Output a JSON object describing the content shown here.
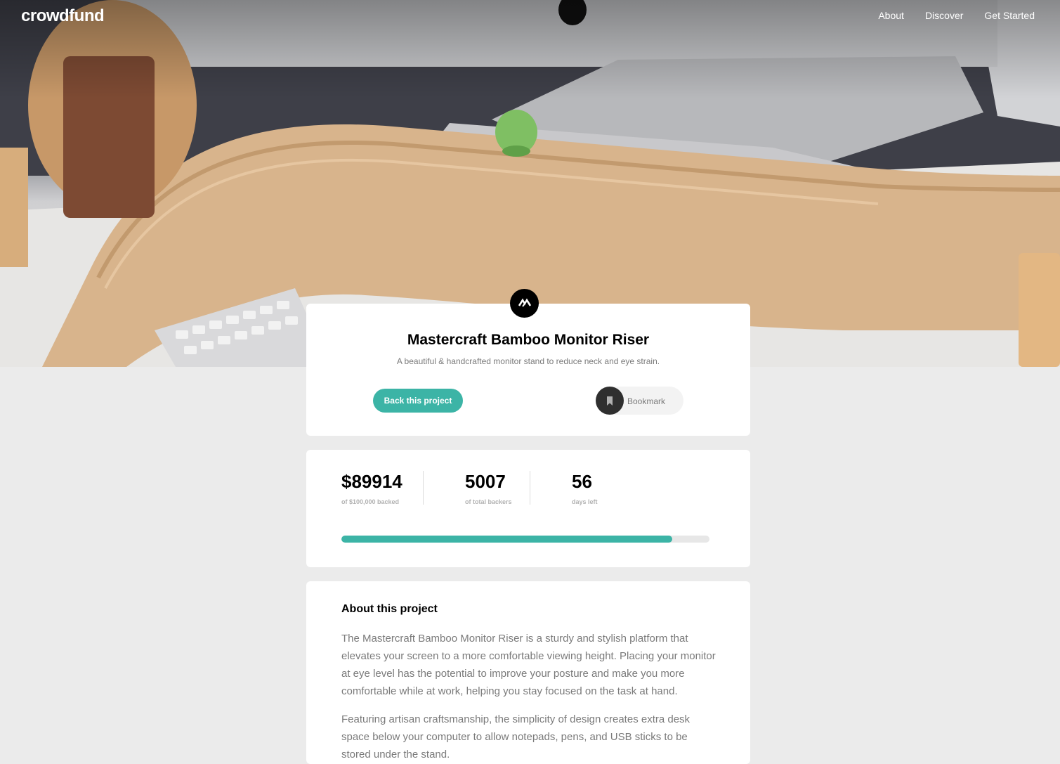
{
  "header": {
    "logo": "crowdfund",
    "nav": [
      "About",
      "Discover",
      "Get Started"
    ]
  },
  "project": {
    "logo_icon": "mastercraft-logo-icon",
    "title": "Mastercraft Bamboo Monitor Riser",
    "subtitle": "A beautiful & handcrafted monitor stand to reduce neck and eye strain.",
    "back_label": "Back this project",
    "bookmark_label": "Bookmark",
    "bookmark_icon": "bookmark-icon"
  },
  "stats": {
    "backed_value": "$89914",
    "backed_label": "of $100,000 backed",
    "backers_value": "5007",
    "backers_label": "of total backers",
    "days_value": "56",
    "days_label": "days left",
    "progress_fraction": 0.89914
  },
  "about": {
    "heading": "About this project",
    "p1": "The Mastercraft Bamboo Monitor Riser is a sturdy and stylish platform that elevates your screen to a more comfortable viewing height. Placing your monitor at eye level has the potential to improve your posture and make you more comfortable while at work, helping you stay focused on the task at hand.",
    "p2": "Featuring artisan craftsmanship, the simplicity of design creates extra desk space below your computer to allow notepads, pens, and USB sticks to be stored under the stand."
  },
  "colors": {
    "accent": "#3cb4a6",
    "background": "#ebebeb",
    "card": "#ffffff",
    "text_muted": "#7a7a7a"
  }
}
